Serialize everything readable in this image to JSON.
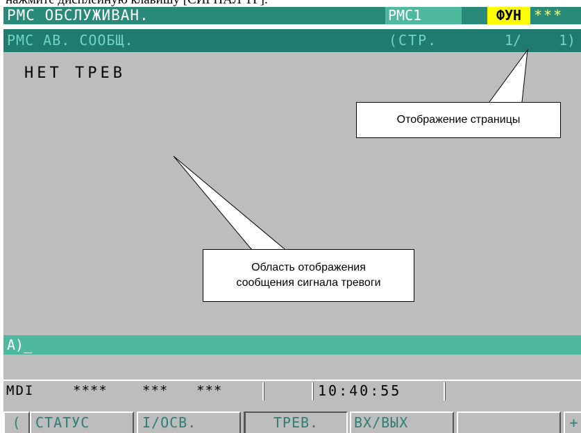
{
  "document": {
    "top_text": "нажмите дисплейную клавишу [СИГНАЛ ТР]."
  },
  "header": {
    "title": "PMC ОБСЛУЖИВАН.",
    "pmc_label": "PMC1",
    "fun_label": "ФУН",
    "stars": "***"
  },
  "subheader": {
    "title": "PMC АВ. СООБЩ.",
    "page_label": "(СТР.",
    "page_current": "1/",
    "page_total": "1)"
  },
  "main": {
    "message": "НЕТ ТРЕВ"
  },
  "callouts": {
    "page_display": "Отображение страницы",
    "area_line1": "Область отображения",
    "area_line2": "сообщения сигнала тревоги"
  },
  "input": {
    "prompt": "A)_"
  },
  "status": {
    "mode": "MDI",
    "group1": "****",
    "group2": "***",
    "group3": "***",
    "time": "10:40:55"
  },
  "softkeys": {
    "left_arrow": "(",
    "status": "СТАТУС",
    "io": "I/ОСВ.",
    "alarm": "ТРЕВ.",
    "inout": "ВХ/ВЫХ",
    "empty": "",
    "plus": "+"
  },
  "colors": {
    "title_bar": "#2a8a7a",
    "subheader_bar": "#1f7a70",
    "main_background": "#bdbdbd",
    "input_line": "#4fb9a0",
    "fun_highlight": "#ffff00"
  }
}
